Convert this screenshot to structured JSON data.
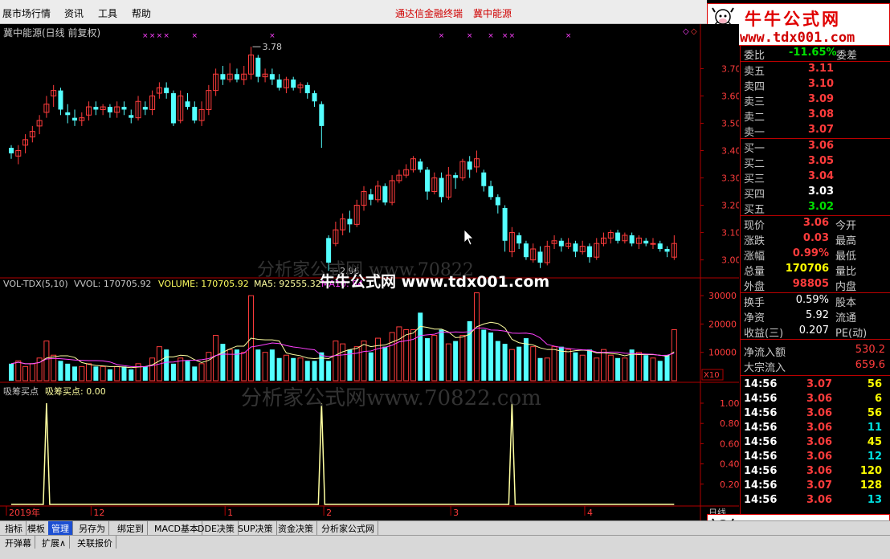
{
  "menubar": {
    "items": [
      "展市场行情",
      "资讯",
      "工具",
      "帮助"
    ],
    "center_title": "通达信金融终端",
    "stock_title": "冀中能源"
  },
  "logo": {
    "title": "牛牛公式网",
    "url": "www.tdx001.com"
  },
  "main_chart": {
    "title": "冀中能源(日线 前复权)",
    "high_label": "3.78",
    "low_label": "2.96",
    "price_ticks": [
      "3.70",
      "3.60",
      "3.50",
      "3.40",
      "3.30",
      "3.20",
      "3.10",
      "3.00"
    ]
  },
  "volume_chart": {
    "title_name": "VOL-TDX(5,10)",
    "vvol_label": "VVOL: 170705.92",
    "volume_label": "VOLUME: 170705.92",
    "ma5_label": "MA5: 92555.32",
    "ma10_label": "MA10: 84",
    "ticks": [
      "30000",
      "20000",
      "10000"
    ],
    "scale_label": "X10"
  },
  "indicator_chart": {
    "title_name": "吸筹买点",
    "value_label": "吸筹买点: 0.00",
    "ticks": [
      "1.00",
      "0.80",
      "0.60",
      "0.40",
      "0.20"
    ]
  },
  "time_axis": {
    "labels": [
      "2019年",
      "12",
      "1",
      "2",
      "3",
      "4"
    ],
    "right_label": "日线"
  },
  "watermarks": {
    "main": "牛牛公式网 www.tdx001.com",
    "gray": "分析家公式网www.70822.com",
    "gray_short": "分析家公式网 www.70822"
  },
  "right_panel": {
    "weibi": {
      "label": "委比",
      "value": "-11.65%",
      "label2": "委差"
    },
    "sell": [
      {
        "label": "卖五",
        "price": "3.11"
      },
      {
        "label": "卖四",
        "price": "3.10"
      },
      {
        "label": "卖三",
        "price": "3.09"
      },
      {
        "label": "卖二",
        "price": "3.08"
      },
      {
        "label": "卖一",
        "price": "3.07"
      }
    ],
    "buy": [
      {
        "label": "买一",
        "price": "3.06",
        "color": "#ff3c3c"
      },
      {
        "label": "买二",
        "price": "3.05",
        "color": "#ff3c3c"
      },
      {
        "label": "买三",
        "price": "3.04",
        "color": "#ff3c3c"
      },
      {
        "label": "买四",
        "price": "3.03",
        "color": "#ffffff"
      },
      {
        "label": "买五",
        "price": "3.02",
        "color": "#00e000"
      }
    ],
    "stats": [
      {
        "label": "现价",
        "value": "3.06",
        "label2": "今开",
        "color": "#ff3c3c"
      },
      {
        "label": "涨跌",
        "value": "0.03",
        "label2": "最高",
        "color": "#ff3c3c"
      },
      {
        "label": "涨幅",
        "value": "0.99%",
        "label2": "最低",
        "color": "#ff3c3c"
      },
      {
        "label": "总量",
        "value": "170706",
        "label2": "量比",
        "color": "#ffff00"
      },
      {
        "label": "外盘",
        "value": "98805",
        "label2": "内盘",
        "color": "#ff3c3c"
      }
    ],
    "stats2": [
      {
        "label": "换手",
        "value": "0.59%",
        "label2": "股本"
      },
      {
        "label": "净资",
        "value": "5.92",
        "label2": "流通"
      },
      {
        "label": "收益(三)",
        "value": "0.207",
        "label2": "PE(动)"
      }
    ],
    "flows": [
      {
        "label": "净流入额",
        "value": "530.2"
      },
      {
        "label": "大宗流入",
        "value": "659.6"
      }
    ],
    "ticks": [
      {
        "time": "14:56",
        "price": "3.07",
        "vol": "56",
        "pc": "#ff3c3c",
        "vc": "#ffff00"
      },
      {
        "time": "14:56",
        "price": "3.06",
        "vol": "6",
        "pc": "#ff3c3c",
        "vc": "#ffff00"
      },
      {
        "time": "14:56",
        "price": "3.06",
        "vol": "56",
        "pc": "#ff3c3c",
        "vc": "#ffff00"
      },
      {
        "time": "14:56",
        "price": "3.06",
        "vol": "11",
        "pc": "#ff3c3c",
        "vc": "#00e0e0"
      },
      {
        "time": "14:56",
        "price": "3.06",
        "vol": "45",
        "pc": "#ff3c3c",
        "vc": "#ffff00"
      },
      {
        "time": "14:56",
        "price": "3.06",
        "vol": "12",
        "pc": "#ff3c3c",
        "vc": "#00e0e0"
      },
      {
        "time": "14:56",
        "price": "3.06",
        "vol": "120",
        "pc": "#ff3c3c",
        "vc": "#ffff00"
      },
      {
        "time": "14:56",
        "price": "3.07",
        "vol": "128",
        "pc": "#ff3c3c",
        "vc": "#ffff00"
      },
      {
        "time": "14:56",
        "price": "3.06",
        "vol": "13",
        "pc": "#ff3c3c",
        "vc": "#00e0e0"
      }
    ]
  },
  "toolbar": {
    "tabs": [
      "指标",
      "模板",
      "管理",
      "另存为",
      "绑定到",
      "MACD基本",
      "DDE决策",
      "SUP决策",
      "资金决策",
      "分析家公式网"
    ],
    "active_tab": "管理",
    "status_tabs": [
      "开弹幕",
      "扩展∧",
      "关联报价"
    ]
  },
  "colors": {
    "up": "#ff3c3c",
    "down": "#54ffff",
    "ma_yellow": "#ffffa0",
    "ma_magenta": "#ff40ff",
    "axis_red": "#b00000",
    "indicator_yellow": "#ffffa0"
  },
  "chart_data": {
    "type": "candlestick",
    "price_range": [
      2.94,
      3.81
    ],
    "candles": [
      [
        3.41,
        3.39,
        3.42,
        3.37
      ],
      [
        3.38,
        3.4,
        3.42,
        3.35
      ],
      [
        3.42,
        3.44,
        3.46,
        3.39
      ],
      [
        3.45,
        3.47,
        3.49,
        3.43
      ],
      [
        3.49,
        3.51,
        3.53,
        3.46
      ],
      [
        3.54,
        3.57,
        3.6,
        3.52
      ],
      [
        3.6,
        3.62,
        3.64,
        3.56
      ],
      [
        3.62,
        3.55,
        3.63,
        3.53
      ],
      [
        3.54,
        3.53,
        3.57,
        3.5
      ],
      [
        3.52,
        3.51,
        3.55,
        3.49
      ],
      [
        3.51,
        3.52,
        3.54,
        3.49
      ],
      [
        3.53,
        3.56,
        3.58,
        3.51
      ],
      [
        3.56,
        3.55,
        3.58,
        3.53
      ],
      [
        3.55,
        3.56,
        3.57,
        3.53
      ],
      [
        3.56,
        3.54,
        3.57,
        3.52
      ],
      [
        3.54,
        3.56,
        3.58,
        3.52
      ],
      [
        3.56,
        3.55,
        3.58,
        3.53
      ],
      [
        3.53,
        3.52,
        3.55,
        3.5
      ],
      [
        3.52,
        3.58,
        3.6,
        3.51
      ],
      [
        3.56,
        3.55,
        3.58,
        3.53
      ],
      [
        3.55,
        3.6,
        3.62,
        3.53
      ],
      [
        3.61,
        3.63,
        3.65,
        3.59
      ],
      [
        3.63,
        3.61,
        3.65,
        3.59
      ],
      [
        3.61,
        3.5,
        3.62,
        3.49
      ],
      [
        3.51,
        3.6,
        3.62,
        3.5
      ],
      [
        3.58,
        3.56,
        3.61,
        3.55
      ],
      [
        3.56,
        3.51,
        3.58,
        3.5
      ],
      [
        3.51,
        3.55,
        3.58,
        3.49
      ],
      [
        3.55,
        3.62,
        3.64,
        3.53
      ],
      [
        3.62,
        3.68,
        3.7,
        3.6
      ],
      [
        3.68,
        3.66,
        3.71,
        3.64
      ],
      [
        3.66,
        3.68,
        3.72,
        3.65
      ],
      [
        3.68,
        3.66,
        3.7,
        3.65
      ],
      [
        3.66,
        3.68,
        3.71,
        3.64
      ],
      [
        3.68,
        3.75,
        3.78,
        3.66
      ],
      [
        3.74,
        3.67,
        3.75,
        3.65
      ],
      [
        3.67,
        3.68,
        3.7,
        3.65
      ],
      [
        3.68,
        3.66,
        3.7,
        3.64
      ],
      [
        3.66,
        3.63,
        3.68,
        3.62
      ],
      [
        3.63,
        3.66,
        3.67,
        3.61
      ],
      [
        3.66,
        3.63,
        3.67,
        3.62
      ],
      [
        3.63,
        3.64,
        3.65,
        3.61
      ],
      [
        3.64,
        3.61,
        3.65,
        3.59
      ],
      [
        3.61,
        3.58,
        3.62,
        3.56
      ],
      [
        3.57,
        3.49,
        3.58,
        3.41
      ],
      [
        3.08,
        2.99,
        3.09,
        2.96
      ],
      [
        3.06,
        3.11,
        3.14,
        3.05
      ],
      [
        3.11,
        3.15,
        3.17,
        3.09
      ],
      [
        3.15,
        3.13,
        3.18,
        3.1
      ],
      [
        3.13,
        3.2,
        3.22,
        3.12
      ],
      [
        3.2,
        3.25,
        3.27,
        3.18
      ],
      [
        3.24,
        3.22,
        3.26,
        3.2
      ],
      [
        3.22,
        3.27,
        3.29,
        3.21
      ],
      [
        3.27,
        3.21,
        3.28,
        3.2
      ],
      [
        3.21,
        3.29,
        3.31,
        3.2
      ],
      [
        3.29,
        3.31,
        3.33,
        3.28
      ],
      [
        3.31,
        3.33,
        3.35,
        3.3
      ],
      [
        3.33,
        3.37,
        3.38,
        3.32
      ],
      [
        3.36,
        3.33,
        3.37,
        3.32
      ],
      [
        3.33,
        3.25,
        3.34,
        3.22
      ],
      [
        3.25,
        3.3,
        3.32,
        3.24
      ],
      [
        3.3,
        3.23,
        3.32,
        3.21
      ],
      [
        3.23,
        3.31,
        3.34,
        3.22
      ],
      [
        3.31,
        3.3,
        3.32,
        3.26
      ],
      [
        3.3,
        3.36,
        3.37,
        3.29
      ],
      [
        3.36,
        3.33,
        3.38,
        3.3
      ],
      [
        3.34,
        3.37,
        3.4,
        3.32
      ],
      [
        3.32,
        3.27,
        3.33,
        3.25
      ],
      [
        3.27,
        3.23,
        3.29,
        3.22
      ],
      [
        3.23,
        3.2,
        3.24,
        3.17
      ],
      [
        3.19,
        3.07,
        3.2,
        3.03
      ],
      [
        3.03,
        3.1,
        3.12,
        3.01
      ],
      [
        3.09,
        3.06,
        3.1,
        3.04
      ],
      [
        3.06,
        3.01,
        3.07,
        3.0
      ],
      [
        3.0,
        3.04,
        3.06,
        2.99
      ],
      [
        3.03,
        2.99,
        3.05,
        2.97
      ],
      [
        2.99,
        3.05,
        3.07,
        2.98
      ],
      [
        3.06,
        3.07,
        3.09,
        3.04
      ],
      [
        3.07,
        3.05,
        3.08,
        3.03
      ],
      [
        3.05,
        3.06,
        3.08,
        3.04
      ],
      [
        3.06,
        3.03,
        3.07,
        3.01
      ],
      [
        3.03,
        3.05,
        3.07,
        3.02
      ],
      [
        3.05,
        3.01,
        3.06,
        2.99
      ],
      [
        3.01,
        3.06,
        3.08,
        3.0
      ],
      [
        3.06,
        3.08,
        3.1,
        3.05
      ],
      [
        3.08,
        3.1,
        3.11,
        3.06
      ],
      [
        3.1,
        3.07,
        3.11,
        3.06
      ],
      [
        3.07,
        3.09,
        3.1,
        3.06
      ],
      [
        3.09,
        3.06,
        3.1,
        3.05
      ],
      [
        3.06,
        3.08,
        3.09,
        3.04
      ],
      [
        3.07,
        3.06,
        3.08,
        3.05
      ],
      [
        3.06,
        3.06,
        3.08,
        3.04
      ],
      [
        3.06,
        3.04,
        3.07,
        3.03
      ],
      [
        3.04,
        3.03,
        3.05,
        3.01
      ],
      [
        3.01,
        3.06,
        3.09,
        3.0
      ]
    ],
    "volumes": [
      6,
      7,
      5,
      6,
      8,
      14,
      9,
      7,
      6,
      5,
      5,
      6,
      5,
      5,
      4,
      5,
      5,
      4,
      6,
      5,
      8,
      12,
      11,
      6,
      8,
      7,
      5,
      6,
      10,
      16,
      13,
      11,
      11,
      10,
      30,
      11,
      10,
      11,
      8,
      9,
      8,
      8,
      7,
      7,
      10,
      7,
      14,
      13,
      11,
      12,
      14,
      10,
      15,
      12,
      17,
      19,
      18,
      18,
      24,
      15,
      16,
      18,
      13,
      14,
      16,
      21,
      31,
      18,
      17,
      14,
      13,
      11,
      12,
      15,
      12,
      8,
      8,
      12,
      12,
      11,
      10,
      9,
      11,
      8,
      11,
      9,
      8,
      8,
      11,
      10,
      9,
      8,
      7,
      9,
      18
    ],
    "signals": [
      5,
      44,
      71
    ]
  }
}
